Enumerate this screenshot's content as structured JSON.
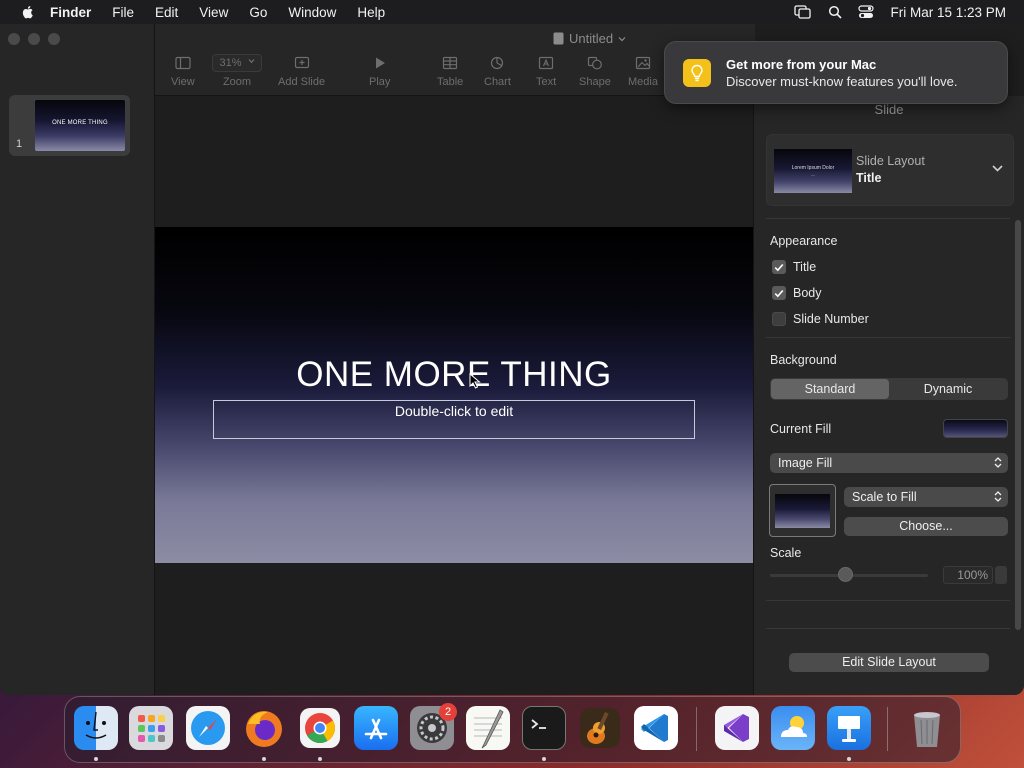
{
  "menubar": {
    "app_name": "Finder",
    "items": [
      "File",
      "Edit",
      "View",
      "Go",
      "Window",
      "Help"
    ],
    "clock": "Fri Mar 15  1:23 PM"
  },
  "window": {
    "doc_title": "Untitled",
    "toolbar": {
      "view": "View",
      "zoom_value": "31%",
      "zoom": "Zoom",
      "add_slide": "Add Slide",
      "play": "Play",
      "table": "Table",
      "chart": "Chart",
      "text": "Text",
      "shape": "Shape",
      "media": "Media"
    }
  },
  "navigator": {
    "slide_number": "1",
    "thumb_text": "ONE MORE THING"
  },
  "slide": {
    "title": "ONE MORE THING",
    "body_placeholder": "Double-click to edit"
  },
  "notification": {
    "title": "Get more from your Mac",
    "body": "Discover must-know features you'll love."
  },
  "inspector": {
    "tab": "Slide",
    "layout_label": "Slide Layout",
    "layout_value": "Title",
    "layout_thumb_text": "Lorem Ipsum Dolor",
    "appearance_heading": "Appearance",
    "appearance": {
      "title_label": "Title",
      "body_label": "Body",
      "slide_number_label": "Slide Number",
      "title_checked": true,
      "body_checked": true,
      "slide_number_checked": false
    },
    "background_heading": "Background",
    "segments": [
      "Standard",
      "Dynamic"
    ],
    "selected_segment": "Standard",
    "current_fill_label": "Current Fill",
    "fill_type": "Image Fill",
    "scale_mode": "Scale to Fill",
    "choose_button": "Choose...",
    "scale_label": "Scale",
    "scale_value": "100%",
    "edit_layout_button": "Edit Slide Layout"
  },
  "dock": {
    "apps": [
      "Finder",
      "Launchpad",
      "Safari",
      "Firefox",
      "Chrome",
      "App Store",
      "System Settings",
      "TextEdit",
      "Terminal",
      "GarageBand",
      "Visual Studio Code",
      "Visual Studio",
      "Weather",
      "Keynote",
      "Trash"
    ],
    "settings_badge": "2"
  },
  "colors": {
    "accent_notification": "#f3c11a",
    "badge": "#e3403a"
  }
}
